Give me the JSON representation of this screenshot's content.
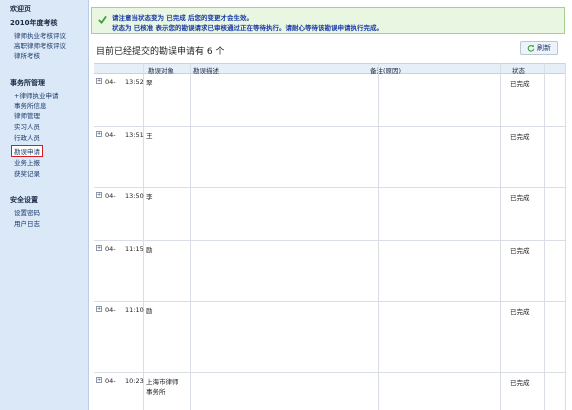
{
  "sidebar": {
    "welcome": "欢迎页",
    "section1_title": "2010年度考核",
    "section1_items": [
      "律师执业考核评议",
      "高职律师考核评议",
      "律所考核"
    ],
    "section2_title": "事务所管理",
    "section2_items": [
      "+律师执业申请",
      "事务所信息",
      "律师管理",
      "实习人员",
      "行政人员",
      "勘误申请",
      "业务上报",
      "获奖记录"
    ],
    "section3_title": "安全设置",
    "section3_items": [
      "设置密码",
      "用户日志"
    ]
  },
  "notice": {
    "line1": "请注意当状态变为 已完成 后您的变更才会生效。",
    "line2": "状态为 已核准 表示您的勘误请求已审核通过正在等待执行。请耐心等待该勘误申请执行完成。"
  },
  "header": {
    "title": "目前已经提交的勘误申请有  6 个",
    "refresh_label": "刷新"
  },
  "table": {
    "columns": [
      "勘误对象",
      "勘误描述",
      "备注(原因)",
      "状态"
    ],
    "rows": [
      {
        "date": "04-",
        "time": "13:52",
        "who": "翠",
        "status": "已完成"
      },
      {
        "date": "04-",
        "time": "13:51",
        "who": "王",
        "status": "已完成"
      },
      {
        "date": "04-",
        "time": "13:50",
        "who": "李",
        "status": "已完成"
      },
      {
        "date": "04-",
        "time": "11:15",
        "who": "励",
        "status": "已完成"
      },
      {
        "date": "04-",
        "time": "11:10",
        "who": "励",
        "status": "已完成"
      },
      {
        "date": "04-",
        "time": "10:23",
        "who": "上海市律师事务所",
        "status": "已完成"
      }
    ]
  },
  "colors": {
    "sidebar_bg": "#dbe8f7",
    "notice_bg": "#e9f6e2",
    "notice_text": "#1a3aa8",
    "highlight": "#d3201f",
    "check_green": "#3aa23a"
  },
  "icons": {
    "notice": "check-icon",
    "refresh": "refresh-icon",
    "expand": "expand-icon"
  }
}
